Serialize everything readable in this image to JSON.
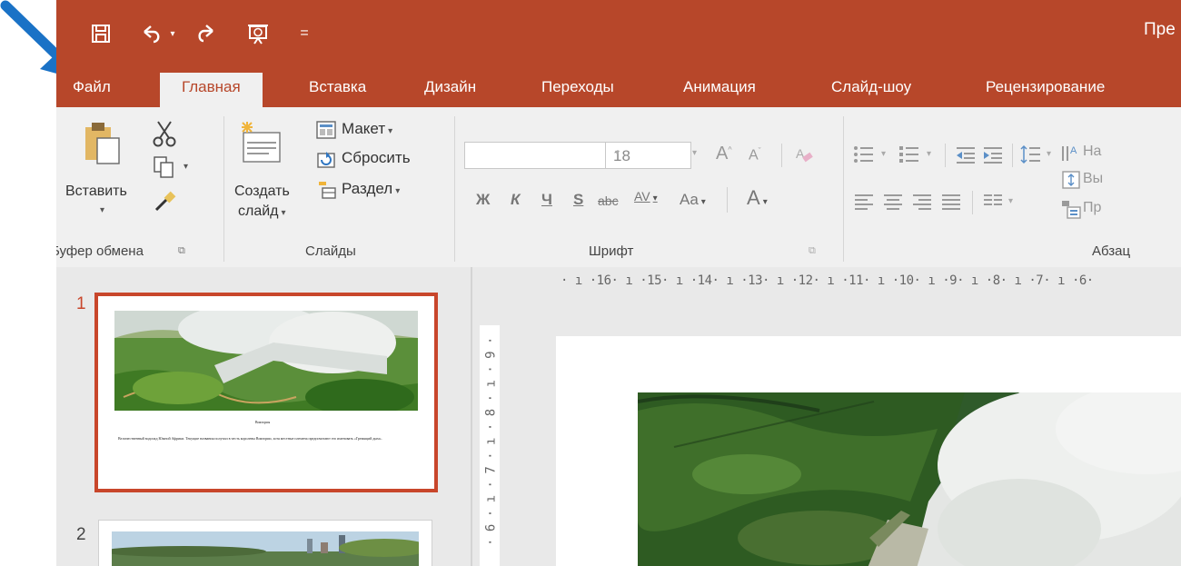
{
  "qat": {
    "save_icon": "save-icon",
    "undo_icon": "undo-icon",
    "redo_icon": "redo-icon",
    "present_icon": "start-slideshow-icon",
    "customize_glyph": "="
  },
  "window": {
    "title": "Пре"
  },
  "tabs": [
    "Файл",
    "Главная",
    "Вставка",
    "Дизайн",
    "Переходы",
    "Анимация",
    "Слайд-шоу",
    "Рецензирование"
  ],
  "active_tab": "Главная",
  "ribbon": {
    "clipboard": {
      "paste_label": "Вставить",
      "group_label": "Буфер обмена"
    },
    "slides": {
      "new_slide_line1": "Создать",
      "new_slide_line2": "слайд",
      "layout": "Макет",
      "reset": "Сбросить",
      "section": "Раздел",
      "group_label": "Слайды"
    },
    "font": {
      "font_name": "",
      "font_size": "18",
      "grow": "A",
      "shrink": "A",
      "bold": "Ж",
      "italic": "К",
      "underline": "Ч",
      "shadow": "S",
      "strike": "abc",
      "spacing": "AV",
      "case": "Aa",
      "color": "A",
      "group_label": "Шрифт"
    },
    "paragraph": {
      "group_label": "Абзац",
      "text_dir_partial": "На",
      "align_partial": "Вы",
      "smartart_partial": "Пр"
    }
  },
  "ruler": {
    "horizontal": "· ı ·16· ı ·15· ı ·14· ı ·13· ı ·12· ı ·11· ı ·10· ı ·9· ı ·8· ı ·7· ı ·6·",
    "vertical": "· 6 · ı · 7 · ı · 8 · ı · 9 ·"
  },
  "slides": [
    {
      "number": "1",
      "title": "Виктория",
      "body": "Величественный водопад Южной Африки. Текущие названия получил в честь королевы Виктории, хотя местные племена предпочитают его именовать «Гремящий дым»."
    },
    {
      "number": "2"
    }
  ],
  "colors": {
    "accent": "#b7472a",
    "selected_border": "#c8462b",
    "annotation_arrow": "#1a72c6"
  }
}
